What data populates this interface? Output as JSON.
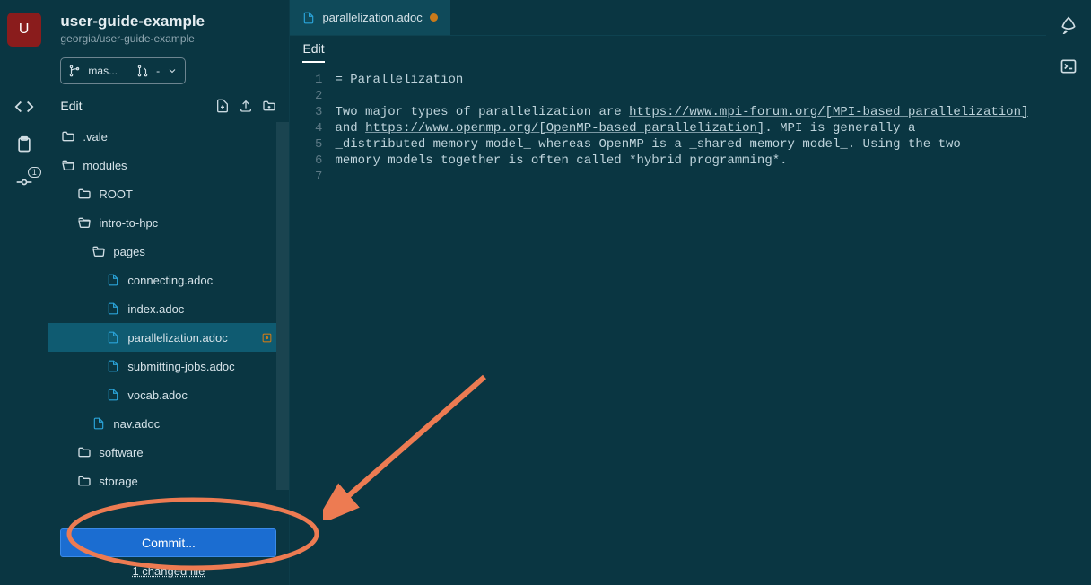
{
  "project": {
    "title": "user-guide-example",
    "subtitle": "georgia/user-guide-example",
    "avatar_letter": "U"
  },
  "iconbar": {
    "commits_badge": "1"
  },
  "branch": {
    "name_short": "mas...",
    "merge_icon_label": "-"
  },
  "sidebar_header": {
    "edit_label": "Edit"
  },
  "tree": [
    {
      "depth": 1,
      "kind": "folder",
      "name": ".vale"
    },
    {
      "depth": 1,
      "kind": "folder",
      "name": "modules",
      "open": true
    },
    {
      "depth": 2,
      "kind": "folder",
      "name": "ROOT"
    },
    {
      "depth": 2,
      "kind": "folder",
      "name": "intro-to-hpc",
      "open": true
    },
    {
      "depth": 3,
      "kind": "folder",
      "name": "pages",
      "open": true
    },
    {
      "depth": 4,
      "kind": "file",
      "name": "connecting.adoc"
    },
    {
      "depth": 4,
      "kind": "file",
      "name": "index.adoc"
    },
    {
      "depth": 4,
      "kind": "file",
      "name": "parallelization.adoc",
      "selected": true,
      "modified": true
    },
    {
      "depth": 4,
      "kind": "file",
      "name": "submitting-jobs.adoc"
    },
    {
      "depth": 4,
      "kind": "file",
      "name": "vocab.adoc"
    },
    {
      "depth": 3,
      "kind": "file",
      "name": "nav.adoc"
    },
    {
      "depth": 2,
      "kind": "folder",
      "name": "software"
    },
    {
      "depth": 2,
      "kind": "folder",
      "name": "storage"
    }
  ],
  "commit": {
    "button_label": "Commit...",
    "changed_label": "1 changed file"
  },
  "tab": {
    "filename": "parallelization.adoc",
    "dirty": true
  },
  "editor_sub": {
    "label": "Edit"
  },
  "editor_lines": [
    "= Parallelization",
    "",
    "Two major types of parallelization are https://www.mpi-forum.org/[MPI-based parallelization]",
    "and https://www.openmp.org/[OpenMP-based parallelization]. MPI is generally a",
    "_distributed memory model_ whereas OpenMP is a _shared memory model_. Using the two",
    "memory models together is often called *hybrid programming*.",
    ""
  ]
}
